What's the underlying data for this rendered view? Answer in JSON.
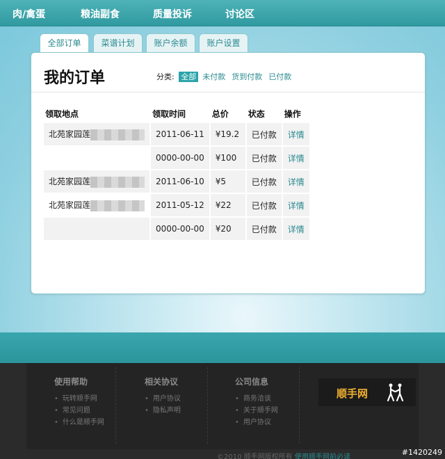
{
  "topnav": [
    "肉/禽蛋",
    "粮油副食",
    "质量投诉",
    "讨论区"
  ],
  "tabs": [
    "全部订单",
    "菜谱计划",
    "账户余额",
    "账户设置"
  ],
  "page_title": "我的订单",
  "filter": {
    "label": "分类:",
    "options": [
      "全部",
      "未付款",
      "货到付款",
      "已付款"
    ]
  },
  "table": {
    "headers": [
      "领取地点",
      "领取时间",
      "总价",
      "状态",
      "操作"
    ],
    "rows": [
      {
        "location": "北苑家园莲",
        "time": "2011-06-11",
        "price": "¥19.2",
        "status": "已付款",
        "action": "详情"
      },
      {
        "location": "",
        "time": "0000-00-00",
        "price": "¥100",
        "status": "已付款",
        "action": "详情"
      },
      {
        "location": "北苑家园莲",
        "time": "2011-06-10",
        "price": "¥5",
        "status": "已付款",
        "action": "详情"
      },
      {
        "location": "北苑家园莲",
        "time": "2011-05-12",
        "price": "¥22",
        "status": "已付款",
        "action": "详情"
      },
      {
        "location": "",
        "time": "0000-00-00",
        "price": "¥20",
        "status": "已付款",
        "action": "详情"
      }
    ]
  },
  "footer": {
    "columns": [
      {
        "title": "使用帮助",
        "items": [
          "玩转顺手网",
          "常见问题",
          "什么是顺手网"
        ]
      },
      {
        "title": "相关协议",
        "items": [
          "用户协议",
          "隐私声明"
        ]
      },
      {
        "title": "公司信息",
        "items": [
          "商务洽谈",
          "关于顺手网",
          "用户协议"
        ]
      }
    ],
    "brand": "顺手网",
    "copyright": "©2010 顺手网版权所有",
    "copyright_link": "使用顺手网前必读"
  },
  "image_id": "#1420249",
  "colors": {
    "accent": "#2aa4aa",
    "link": "#2b8a90",
    "brand": "#f0b030"
  }
}
